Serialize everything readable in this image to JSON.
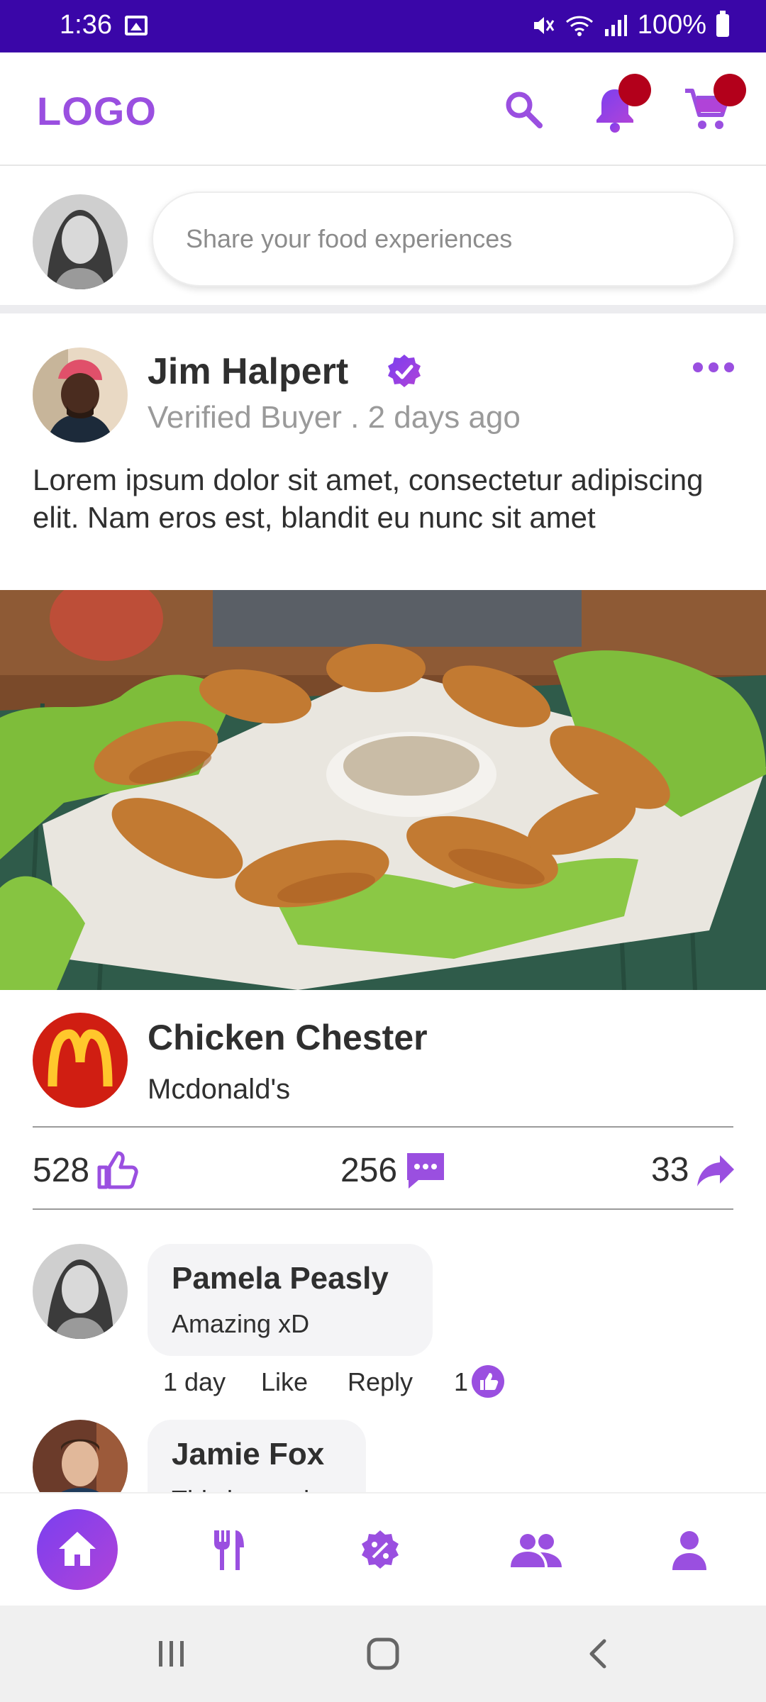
{
  "status_bar": {
    "time": "1:36",
    "battery": "100%"
  },
  "header": {
    "logo": "LOGO"
  },
  "composer": {
    "placeholder": "Share your food experiences"
  },
  "post": {
    "author": "Jim Halpert",
    "meta": "Verified Buyer . 2 days ago",
    "text": "Lorem ipsum dolor sit amet, consectetur adipiscing elit. Nam eros est, blandit eu nunc sit amet",
    "restaurant": {
      "dish": "Chicken Chester",
      "name": "Mcdonald's"
    },
    "stats": {
      "likes": "528",
      "comments": "256",
      "shares": "33"
    }
  },
  "comments": [
    {
      "name": "Pamela Peasly",
      "text": "Amazing xD",
      "time": "1 day",
      "like": "Like",
      "reply": "Reply",
      "likes": "1"
    },
    {
      "name": "Jamie Fox",
      "text": "This is good"
    }
  ],
  "colors": {
    "accent": "#9a4fe0",
    "status_bar": "#3a06a8",
    "badge": "#b3001b"
  },
  "icons": [
    "search-icon",
    "bell-icon",
    "cart-icon",
    "verified-icon",
    "more-icon",
    "thumbs-up-icon",
    "comment-icon",
    "share-icon",
    "home-icon",
    "restaurant-icon",
    "discount-icon",
    "group-icon",
    "person-icon"
  ]
}
